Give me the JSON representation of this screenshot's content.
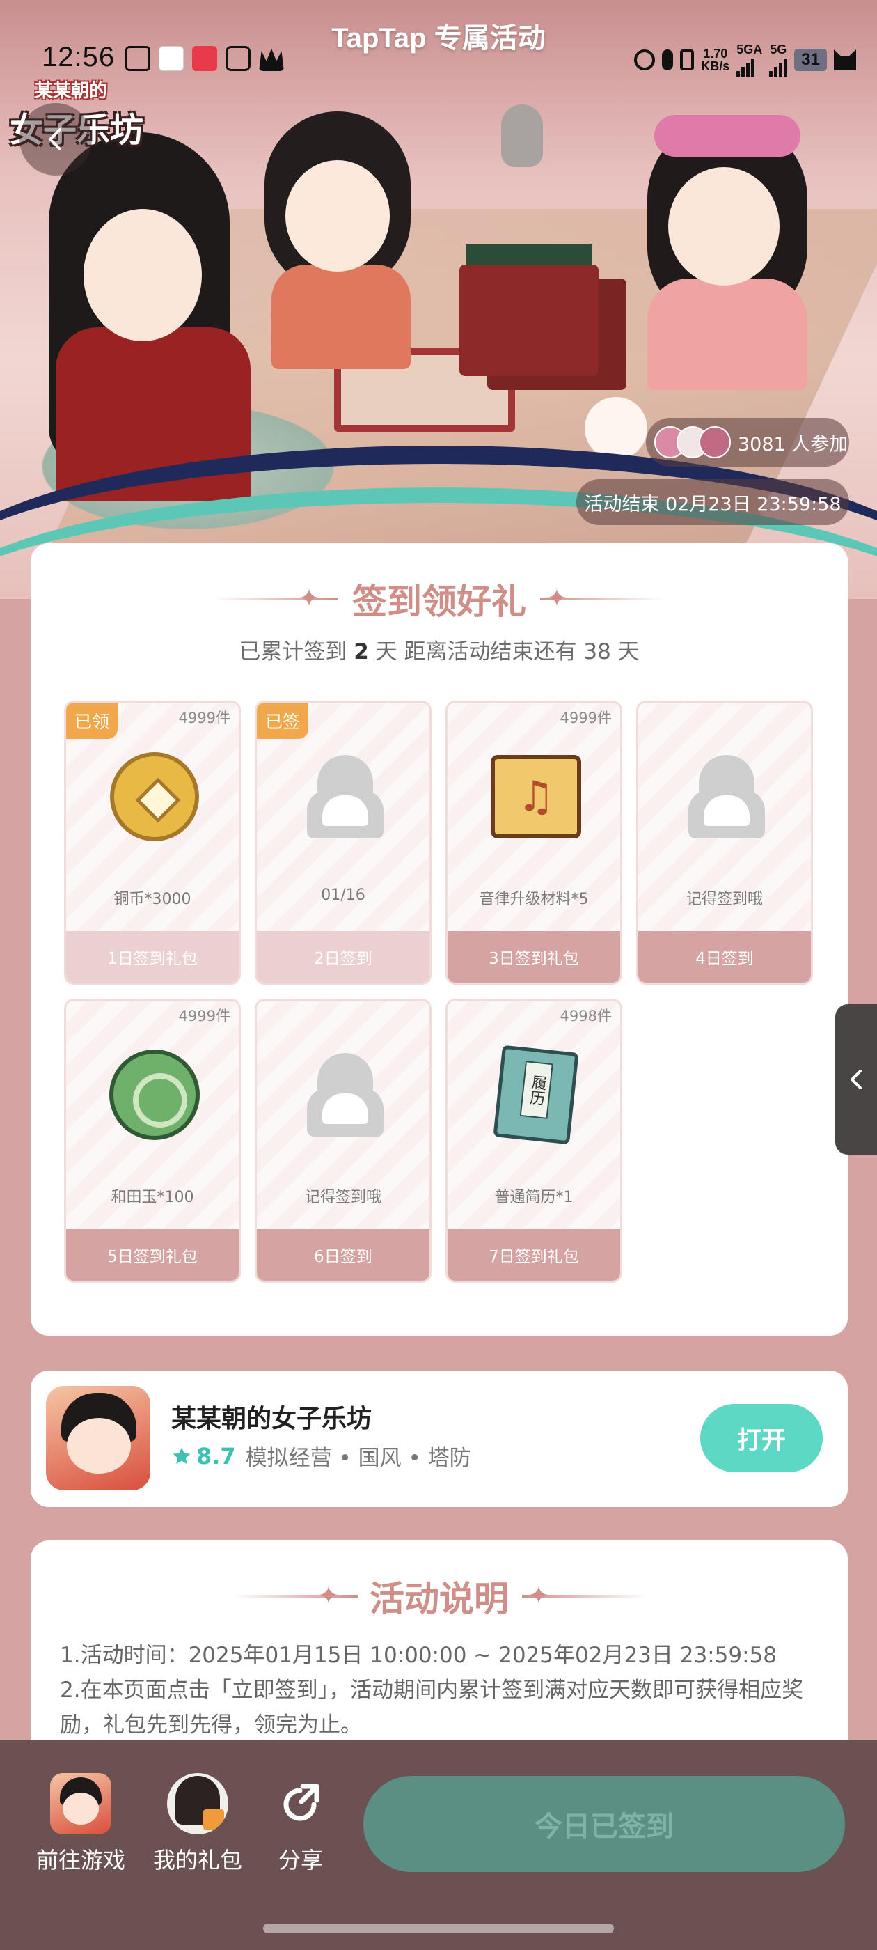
{
  "status_bar": {
    "time": "12:56",
    "title": "TapTap 专属活动",
    "net_speed_value": "1.70",
    "net_speed_unit": "KB/s",
    "sig1_label": "5GA",
    "sig2_label": "5G",
    "battery": "31"
  },
  "hero": {
    "logo_line1": "某某朝的",
    "logo_line2": "女子乐坊",
    "participants": "3081 人参加",
    "end_time": "活动结束 02月23日 23:59:58"
  },
  "signin": {
    "title": "签到领好礼",
    "summary_prefix": "已累计签到",
    "summary_count": "2",
    "summary_mid": "天   距离活动结束还有",
    "summary_days_left": "38",
    "summary_suffix": "天",
    "days": [
      {
        "tag": "已领",
        "stock": "4999件",
        "label": "铜币*3000",
        "button": "1日签到礼包",
        "icon": "coin-icon"
      },
      {
        "tag": "已签",
        "stock": "",
        "label": "01/16",
        "button": "2日签到",
        "icon": "placeholder-figure-icon"
      },
      {
        "tag": "",
        "stock": "4999件",
        "label": "音律升级材料*5",
        "button": "3日签到礼包",
        "icon": "music-scroll-icon"
      },
      {
        "tag": "",
        "stock": "",
        "label": "记得签到哦",
        "button": "4日签到",
        "icon": "placeholder-figure-icon"
      },
      {
        "tag": "",
        "stock": "4999件",
        "label": "和田玉*100",
        "button": "5日签到礼包",
        "icon": "jade-icon"
      },
      {
        "tag": "",
        "stock": "",
        "label": "记得签到哦",
        "button": "6日签到",
        "icon": "placeholder-figure-icon"
      },
      {
        "tag": "",
        "stock": "4998件",
        "label": "普通简历*1",
        "button": "7日签到礼包",
        "icon": "resume-book-icon"
      }
    ],
    "book_title": "履历"
  },
  "app": {
    "name": "某某朝的女子乐坊",
    "rating": "8.7",
    "tags": "模拟经营 • 国风 • 塔防",
    "open_label": "打开"
  },
  "rules": {
    "title": "活动说明",
    "lines": [
      "1.活动时间：2025年01月15日 10:00:00 ~ 2025年02月23日 23:59:58",
      "2.在本页面点击「立即签到」，活动期间内累计签到满对应天数即可获得相应奖励，礼包先到先得，领完为止。"
    ]
  },
  "bottom_bar": {
    "go_game": "前往游戏",
    "my_gifts": "我的礼包",
    "share": "分享",
    "checked_in": "今日已签到"
  },
  "colors": {
    "page_bg": "#d6a3a3",
    "accent_title": "#cf8e87",
    "tag_orange": "#f0a84a",
    "teal": "#5dd8c5",
    "bottom_bar": "#6b5151"
  }
}
